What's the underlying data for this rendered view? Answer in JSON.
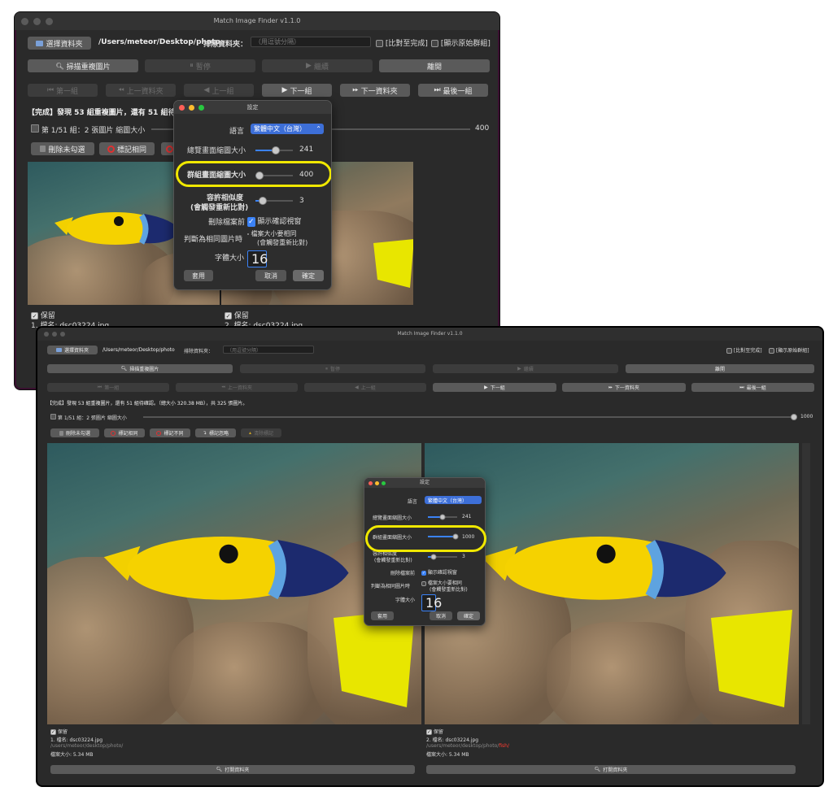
{
  "app": {
    "title": "Match Image Finder v1.1.0"
  },
  "w1": {
    "choose_folder": "選擇資料夾",
    "path": "/Users/meteor/Desktop/photo",
    "exclude_label": "排除資料夾：",
    "exclude_placeholder": "（用逗號分隔）",
    "compare_to_end": "[比對至完成]",
    "show_original_group": "[顯示原始群組]",
    "scan": "掃描重複圖片",
    "pause": "暫停",
    "resume": "繼續",
    "leave": "離開",
    "first_group": "第一組",
    "prev_folder": "上一資料夾",
    "prev_group": "上一組",
    "next_group": "下一組",
    "next_folder": "下一資料夾",
    "last_group": "最後一組",
    "status": "【完成】發現 53 組重複圖片，還有 51 組待確",
    "group_info": "第 1/51 組：2 張圖片",
    "thumb_size_label": "縮圖大小",
    "thumb_size_value": "400",
    "delete_unchecked": "刪除未勾選",
    "mark_same": "標記相同",
    "keep1": "保留",
    "file1": "1. 檔名: dsc03224.jpg",
    "keep2": "保留",
    "file2": "2. 檔名: dsc03224.jpg"
  },
  "dlg1": {
    "title": "設定",
    "language_label": "語言",
    "language_value": "繁體中文（台灣）",
    "browse_thumb_label": "總覽畫面縮圖大小",
    "browse_thumb_value": "241",
    "group_thumb_label": "群組畫面縮圖大小",
    "group_thumb_value": "400",
    "tolerance_label": "容許相似度",
    "tolerance_sub": "(會觸發重新比對)",
    "tolerance_value": "3",
    "before_delete_label": "刪除檔案前",
    "before_delete_option": "顯示確認視窗",
    "same_label": "判斷為相同圖片時",
    "same_option": "檔案大小要相同",
    "same_option_sub": "(會觸發重新比對)",
    "font_label": "字體大小",
    "font_value": "16",
    "apply": "套用",
    "cancel": "取消",
    "ok": "確定"
  },
  "w2": {
    "choose_folder": "選擇資料夾",
    "path": "/Users/meteor/Desktop/photo",
    "exclude_label": "排除資料夾：",
    "exclude_placeholder": "（用逗號分隔）",
    "compare_to_end": "[比對至完成]",
    "show_original_group": "[顯示原始群組]",
    "scan": "掃描重複圖片",
    "pause": "暫停",
    "resume": "繼續",
    "leave": "離開",
    "first_group": "第一組",
    "prev_folder": "上一資料夾",
    "prev_group": "上一組",
    "next_group": "下一組",
    "next_folder": "下一資料夾",
    "last_group": "最後一組",
    "status": "【完成】發現 53 組重複圖片，還有 51 組待確認。（總大小 320.38 MB），共 325 張圖片。",
    "group_info": "第 1/51 組：2 張圖片",
    "thumb_size_label": "縮圖大小",
    "thumb_size_value": "1000",
    "delete_unchecked": "刪除未勾選",
    "mark_same": "標記相同",
    "mark_diff": "標記不同",
    "mark_ignore": "標記忽略",
    "clear_marks": "清除標記",
    "keep1": "保留",
    "file1": "1. 檔名: dsc03224.jpg",
    "path1": "/users/meteor/desktop/photo/",
    "size1": "檔案大小: 5.34 MB",
    "keep2": "保留",
    "file2": "2. 檔名: dsc03224.jpg",
    "path2a": "/users/meteor/desktop/photo/",
    "path2b": "fish/",
    "size2": "檔案大小: 5.34 MB",
    "open_folder1": "打開資料夾",
    "open_folder2": "打開資料夾"
  },
  "dlg2": {
    "title": "設定",
    "language_label": "語言",
    "language_value": "繁體中文（台灣）",
    "browse_thumb_label": "總覽畫面縮圖大小",
    "browse_thumb_value": "241",
    "group_thumb_label": "群組畫面縮圖大小",
    "group_thumb_value": "1000",
    "tolerance_label": "容許相似度",
    "tolerance_sub": "(會觸發重新比對)",
    "tolerance_value": "3",
    "before_delete_label": "刪除檔案前",
    "before_delete_option": "顯示確認視窗",
    "same_label": "判斷為相同圖片時",
    "same_option": "檔案大小要相同",
    "same_option_sub": "(會觸發重新比對)",
    "font_label": "字體大小",
    "font_value": "16",
    "apply": "套用",
    "cancel": "取消",
    "ok": "確定"
  },
  "colors": {
    "accent": "#3b82f6",
    "highlight": "#f0e800",
    "path_red": "#ff3b30"
  },
  "sliders": {
    "w1_thumb": 0.2,
    "w2_thumb": 1.0,
    "dlg1_browse": 0.55,
    "dlg1_group": 0.1,
    "dlg1_tol": 0.2,
    "dlg2_browse": 0.5,
    "dlg2_group": 1.0,
    "dlg2_tol": 0.2
  }
}
